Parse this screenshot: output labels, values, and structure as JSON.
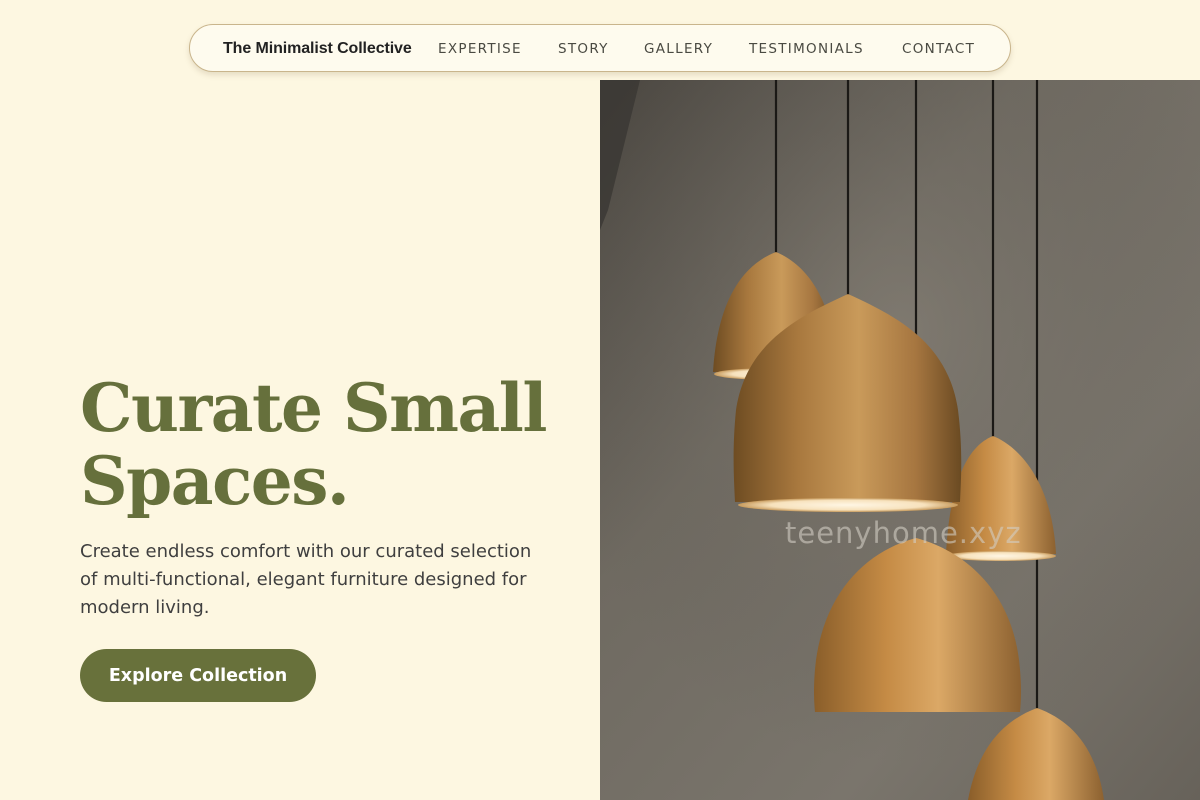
{
  "nav": {
    "brand": "The Minimalist Collective",
    "links": [
      "EXPERTISE",
      "STORY",
      "GALLERY",
      "TESTIMONIALS",
      "CONTACT"
    ]
  },
  "hero": {
    "title_line1": "Curate Small",
    "title_line2": "Spaces.",
    "subtitle": "Create endless comfort with our curated selection of multi-functional, elegant furniture designed for modern living.",
    "cta_label": "Explore Collection"
  },
  "image": {
    "description": "brass pendant lamps",
    "watermark": "teenyhome.xyz"
  },
  "colors": {
    "background": "#fdf7e1",
    "accent": "#68713b",
    "heading": "#66703c",
    "body_text": "#3f3f3f"
  }
}
